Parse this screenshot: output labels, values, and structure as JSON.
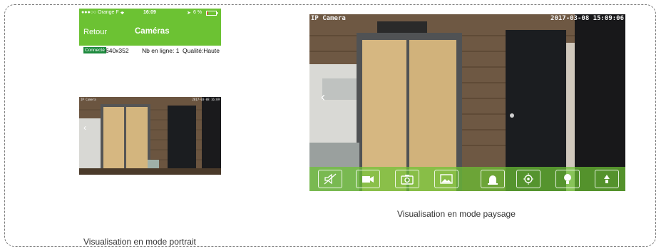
{
  "portrait": {
    "status": {
      "carrier": "●●●○○ Orange F",
      "wifi_icon": "wifi-icon",
      "time": "16:09",
      "battery": "6 %"
    },
    "nav": {
      "back_label": "Retour",
      "title": "Caméras"
    },
    "info": {
      "status_badge": "Connecté",
      "resolution": "640x352",
      "online": "Nb en ligne: 1",
      "quality": "Qualité:Haute"
    },
    "osd_left": "IP Camera",
    "osd_right": "2017-03-08 16:09"
  },
  "landscape": {
    "osd_left": "IP Camera",
    "osd_right": "2017-03-08 15:09:06",
    "toolbar": [
      {
        "name": "mute-button",
        "icon": "speaker-muted-icon"
      },
      {
        "name": "record-button",
        "icon": "video-camera-icon"
      },
      {
        "name": "snapshot-button",
        "icon": "camera-icon"
      },
      {
        "name": "gallery-button",
        "icon": "image-icon"
      },
      {
        "name": "alarm-button",
        "icon": "siren-icon"
      },
      {
        "name": "ptz-button",
        "icon": "crosshair-icon"
      },
      {
        "name": "light-button",
        "icon": "lightbulb-icon"
      },
      {
        "name": "more-button",
        "icon": "more-icon"
      }
    ],
    "toolbar_color": "#6cc233"
  },
  "captions": {
    "portrait": "Visualisation en mode portrait",
    "landscape": "Visualisation en mode paysage"
  },
  "colors": {
    "accent": "#6cc233",
    "connected_badge": "#1e8a3e"
  }
}
